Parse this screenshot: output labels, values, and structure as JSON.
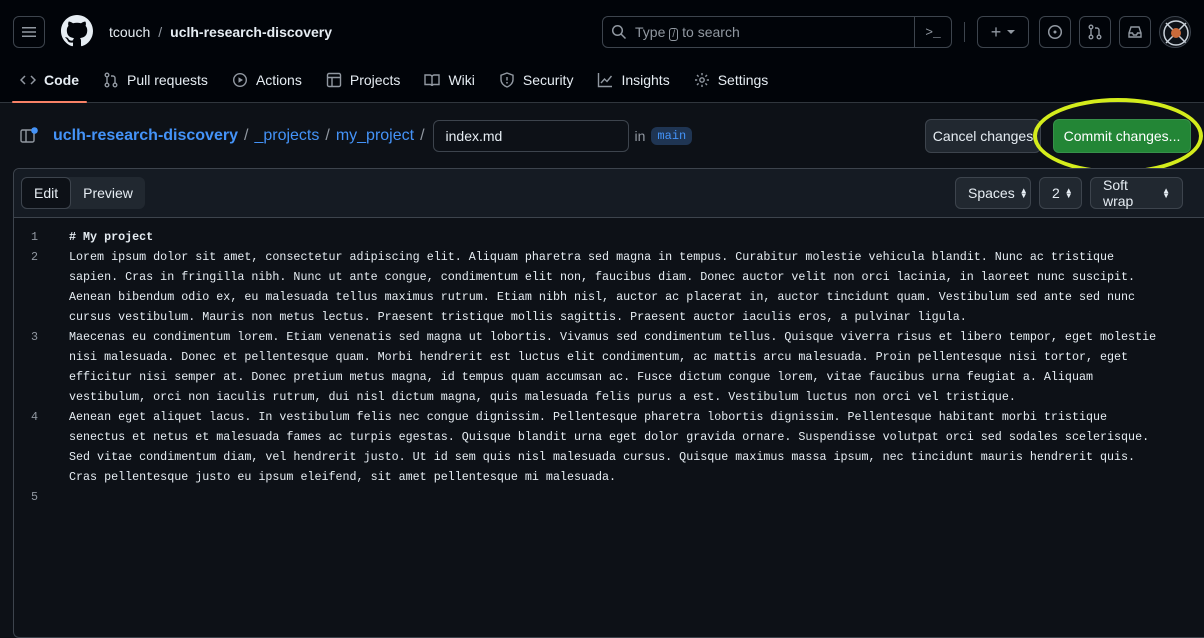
{
  "header": {
    "owner": "tcouch",
    "separator": "/",
    "repo": "uclh-research-discovery",
    "search": {
      "pre": "Type",
      "key": "/",
      "post": "to search"
    },
    "command_icon": ">_",
    "plus_icon": "+",
    "tabs": [
      {
        "label": "Code",
        "icon": "code-icon"
      },
      {
        "label": "Pull requests",
        "icon": "pull-request-icon"
      },
      {
        "label": "Actions",
        "icon": "play-icon"
      },
      {
        "label": "Projects",
        "icon": "table-icon"
      },
      {
        "label": "Wiki",
        "icon": "book-icon"
      },
      {
        "label": "Security",
        "icon": "shield-icon"
      },
      {
        "label": "Insights",
        "icon": "graph-icon"
      },
      {
        "label": "Settings",
        "icon": "gear-icon"
      }
    ]
  },
  "breadcrumb": {
    "parts": [
      "uclh-research-discovery",
      "_projects",
      "my_project"
    ],
    "sep": "/",
    "filename": "index.md",
    "in_label": "in",
    "branch": "main"
  },
  "actions": {
    "cancel": "Cancel changes",
    "commit": "Commit changes..."
  },
  "editor": {
    "tabs": {
      "edit": "Edit",
      "preview": "Preview"
    },
    "indent_mode": "Spaces",
    "indent_size": "2",
    "wrap_mode": "Soft wrap",
    "lines": [
      {
        "num": "1",
        "text": "# My project"
      },
      {
        "num": "2",
        "text": "Lorem ipsum dolor sit amet, consectetur adipiscing elit. Aliquam pharetra sed magna in tempus. Curabitur molestie vehicula blandit. Nunc ac tristique sapien. Cras in fringilla nibh. Nunc ut ante congue, condimentum elit non, faucibus diam. Donec auctor velit non orci lacinia, in laoreet nunc suscipit. Aenean bibendum odio ex, eu malesuada tellus maximus rutrum. Etiam nibh nisl, auctor ac placerat in, auctor tincidunt quam. Vestibulum sed ante sed nunc cursus vestibulum. Mauris non metus lectus. Praesent tristique mollis sagittis. Praesent auctor iaculis eros, a pulvinar ligula."
      },
      {
        "num": "3",
        "text": "Maecenas eu condimentum lorem. Etiam venenatis sed magna ut lobortis. Vivamus sed condimentum tellus. Quisque viverra risus et libero tempor, eget molestie nisi malesuada. Donec et pellentesque quam. Morbi hendrerit est luctus elit condimentum, ac mattis arcu malesuada. Proin pellentesque nisi tortor, eget efficitur nisi semper at. Donec pretium metus magna, id tempus quam accumsan ac. Fusce dictum congue lorem, vitae faucibus urna feugiat a. Aliquam vestibulum, orci non iaculis rutrum, dui nisl dictum magna, quis malesuada felis purus a est. Vestibulum luctus non orci vel tristique."
      },
      {
        "num": "4",
        "text": "Aenean eget aliquet lacus. In vestibulum felis nec congue dignissim. Pellentesque pharetra lobortis dignissim. Pellentesque habitant morbi tristique senectus et netus et malesuada fames ac turpis egestas. Quisque blandit urna eget dolor gravida ornare. Suspendisse volutpat orci sed sodales scelerisque. Sed vitae condimentum diam, vel hendrerit justo. Ut id sem quis nisl malesuada cursus. Quisque maximus massa ipsum, nec tincidunt mauris hendrerit quis. Cras pellentesque justo eu ipsum eleifend, sit amet pellentesque mi malesuada."
      },
      {
        "num": "5",
        "text": ""
      }
    ]
  },
  "colors": {
    "accent_green": "#238636",
    "link_blue": "#4493f8",
    "highlight_circle": "#d4ec1c",
    "tab_underline": "#f78166"
  }
}
